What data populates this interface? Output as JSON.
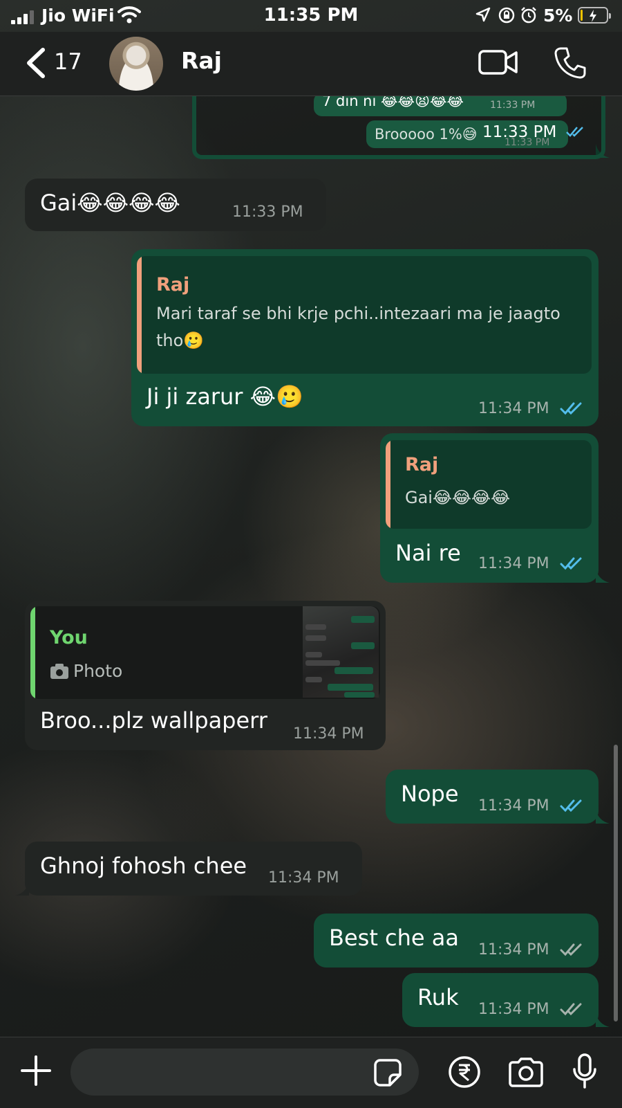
{
  "status_bar": {
    "carrier": "Jio WiFi",
    "time": "11:35 PM",
    "battery": "5%"
  },
  "header": {
    "back_count": "17",
    "contact_name": "Raj",
    "icons": [
      "back-chevron-icon",
      "video-call-icon",
      "phone-call-icon"
    ]
  },
  "cutoff": {
    "line1": "7 din ni 😂😂😫😂😂",
    "line1_time": "11:33 PM",
    "line2": "Brooooo 1%😅",
    "line2_time": "11:33 PM",
    "overlay_time": "11:33 PM"
  },
  "messages": [
    {
      "id": "m1",
      "direction": "incoming",
      "text": "Gai😂😂😂😂",
      "time": "11:33 PM"
    },
    {
      "id": "m2",
      "direction": "outgoing",
      "quote_author": "Raj",
      "quote_text": "Mari taraf se bhi krje pchi..intezaari ma je jaagto tho🥲",
      "text": "Ji ji zarur 😂🥲",
      "time": "11:34 PM",
      "read": true
    },
    {
      "id": "m3",
      "direction": "outgoing",
      "quote_author": "Raj",
      "quote_text": "Gai😂😂😂😂",
      "text": "Nai re",
      "time": "11:34 PM",
      "read": true
    },
    {
      "id": "m4",
      "direction": "incoming",
      "quote_author": "You",
      "quote_text": "Photo",
      "text": "Broo...plz wallpaperr",
      "time": "11:34 PM"
    },
    {
      "id": "m5",
      "direction": "outgoing",
      "text": "Nope",
      "time": "11:34 PM",
      "read": true
    },
    {
      "id": "m6",
      "direction": "incoming",
      "text": "Ghnoj fohosh chee",
      "time": "11:34 PM"
    },
    {
      "id": "m7",
      "direction": "outgoing",
      "text": "Best che aa",
      "time": "11:34 PM",
      "read": false
    },
    {
      "id": "m8",
      "direction": "outgoing",
      "text": "Ruk",
      "time": "11:34 PM",
      "read": false
    }
  ],
  "input_bar": {
    "icons": [
      "plus-icon",
      "sticker-icon",
      "rupee-payment-icon",
      "camera-icon",
      "microphone-icon"
    ]
  },
  "colors": {
    "outgoing_bubble": "#134d37",
    "incoming_bubble": "#222523",
    "read_ticks": "#53bdeb",
    "raj_quote": "#f0a07c",
    "you_quote": "#6fd56f"
  }
}
